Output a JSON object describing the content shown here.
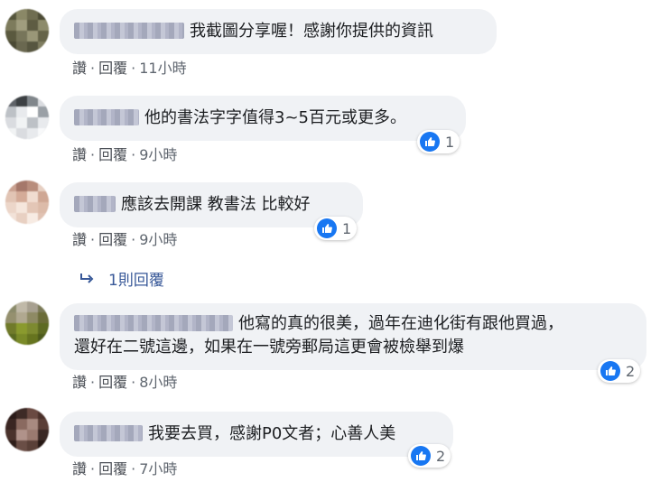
{
  "actions": {
    "like": "讚",
    "separator": "·",
    "reply": "回覆"
  },
  "comments": [
    {
      "text": "我截圖分享喔！感謝你提供的資訊",
      "time": "11小時",
      "reactions": ""
    },
    {
      "text": "他的書法字字值得3~5百元或更多。",
      "time": "9小時",
      "reactions": "1"
    },
    {
      "text": "應該去開課 教書法 比較好",
      "time": "9小時",
      "reactions": "1"
    },
    {
      "text_line1": "他寫的真的很美，過年在迪化街有跟他買過，",
      "text_line2": "還好在二號這邊，如果在一號旁郵局這更會被檢舉到爆",
      "time": "8小時",
      "reactions": "2"
    },
    {
      "text": "我要去買，感謝P0文者；心善人美",
      "time": "7小時",
      "reactions": "2"
    }
  ],
  "replies_link": "1則回覆",
  "colors": {
    "bubble": "#f0f2f5",
    "like_blue": "#1877f2",
    "link": "#385898",
    "meta": "#606770"
  }
}
